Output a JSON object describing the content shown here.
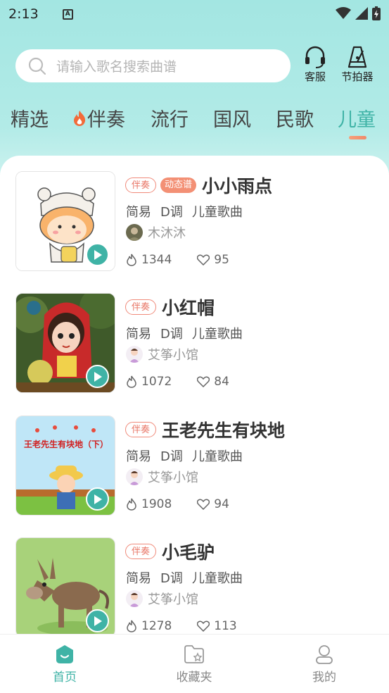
{
  "status": {
    "time": "2:13"
  },
  "search": {
    "placeholder": "请输入歌名搜索曲谱"
  },
  "header_buttons": {
    "service": "客服",
    "metronome": "节拍器"
  },
  "tabs": [
    "精选",
    "伴奏",
    "流行",
    "国风",
    "民歌",
    "儿童"
  ],
  "active_tab": "儿童",
  "songs": [
    {
      "tag": "伴奏",
      "dynamic_tag": "动态谱",
      "title": "小小雨点",
      "difficulty": "简易",
      "key": "D调",
      "category": "儿童歌曲",
      "author": "木沐沐",
      "plays": "1344",
      "likes": "95"
    },
    {
      "tag": "伴奏",
      "title": "小红帽",
      "difficulty": "简易",
      "key": "D调",
      "category": "儿童歌曲",
      "author": "艾筝小馆",
      "plays": "1072",
      "likes": "84"
    },
    {
      "tag": "伴奏",
      "title": "王老先生有块地",
      "difficulty": "简易",
      "key": "D调",
      "category": "儿童歌曲",
      "author": "艾筝小馆",
      "plays": "1908",
      "likes": "94"
    },
    {
      "tag": "伴奏",
      "title": "小毛驴",
      "difficulty": "简易",
      "key": "D调",
      "category": "儿童歌曲",
      "author": "艾筝小馆",
      "plays": "1278",
      "likes": "113"
    }
  ],
  "thumb_text": {
    "song3": "王老先生有块地（下）"
  },
  "nav": {
    "home": "首页",
    "favorites": "收藏夹",
    "mine": "我的"
  },
  "colors": {
    "accent": "#3fb3a6",
    "tag": "#e87565",
    "header_bg": "#a3e6e2"
  }
}
